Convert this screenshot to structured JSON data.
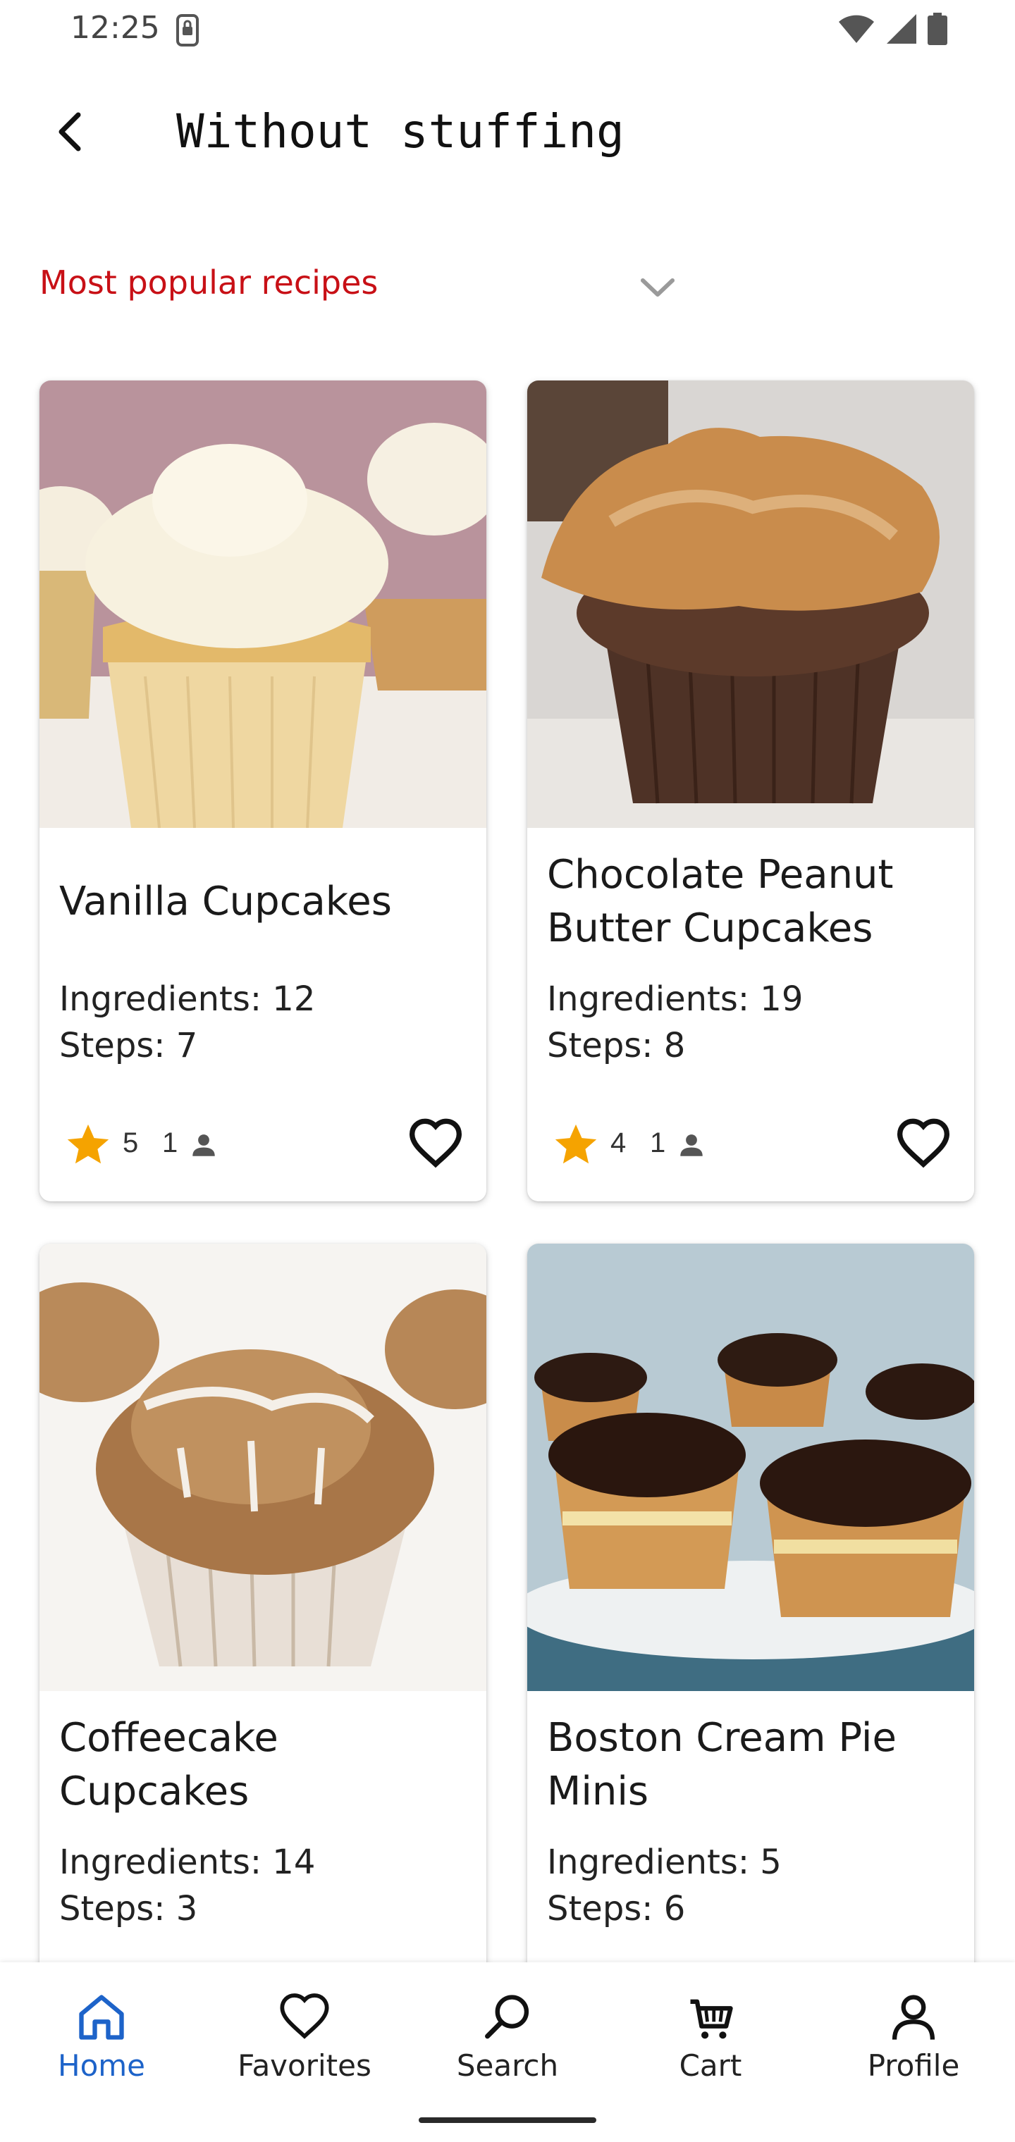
{
  "status_bar": {
    "time": "12:25"
  },
  "header": {
    "title": "Without stuffing"
  },
  "sort": {
    "label": "Most popular recipes"
  },
  "recipes": [
    {
      "title": "Vanilla Cupcakes",
      "ingredients": "Ingredients: 12",
      "steps": "Steps: 7",
      "rating": "5",
      "reviews": "1"
    },
    {
      "title": "Chocolate Peanut Butter Cupcakes",
      "ingredients": "Ingredients: 19",
      "steps": "Steps: 8",
      "rating": "4",
      "reviews": "1"
    },
    {
      "title": "Coffeecake Cupcakes",
      "ingredients": "Ingredients: 14",
      "steps": "Steps: 3"
    },
    {
      "title": "Boston Cream Pie Minis",
      "ingredients": "Ingredients: 5",
      "steps": "Steps: 6"
    }
  ],
  "bottom_nav": {
    "items": [
      {
        "label": "Home",
        "icon": "home-icon",
        "active": true
      },
      {
        "label": "Favorites",
        "icon": "heart-icon",
        "active": false
      },
      {
        "label": "Search",
        "icon": "search-icon",
        "active": false
      },
      {
        "label": "Cart",
        "icon": "cart-icon",
        "active": false
      },
      {
        "label": "Profile",
        "icon": "person-icon",
        "active": false
      }
    ]
  },
  "colors": {
    "accent_red": "#c81016",
    "active_blue": "#1d63c9",
    "star": "#f5a300"
  }
}
